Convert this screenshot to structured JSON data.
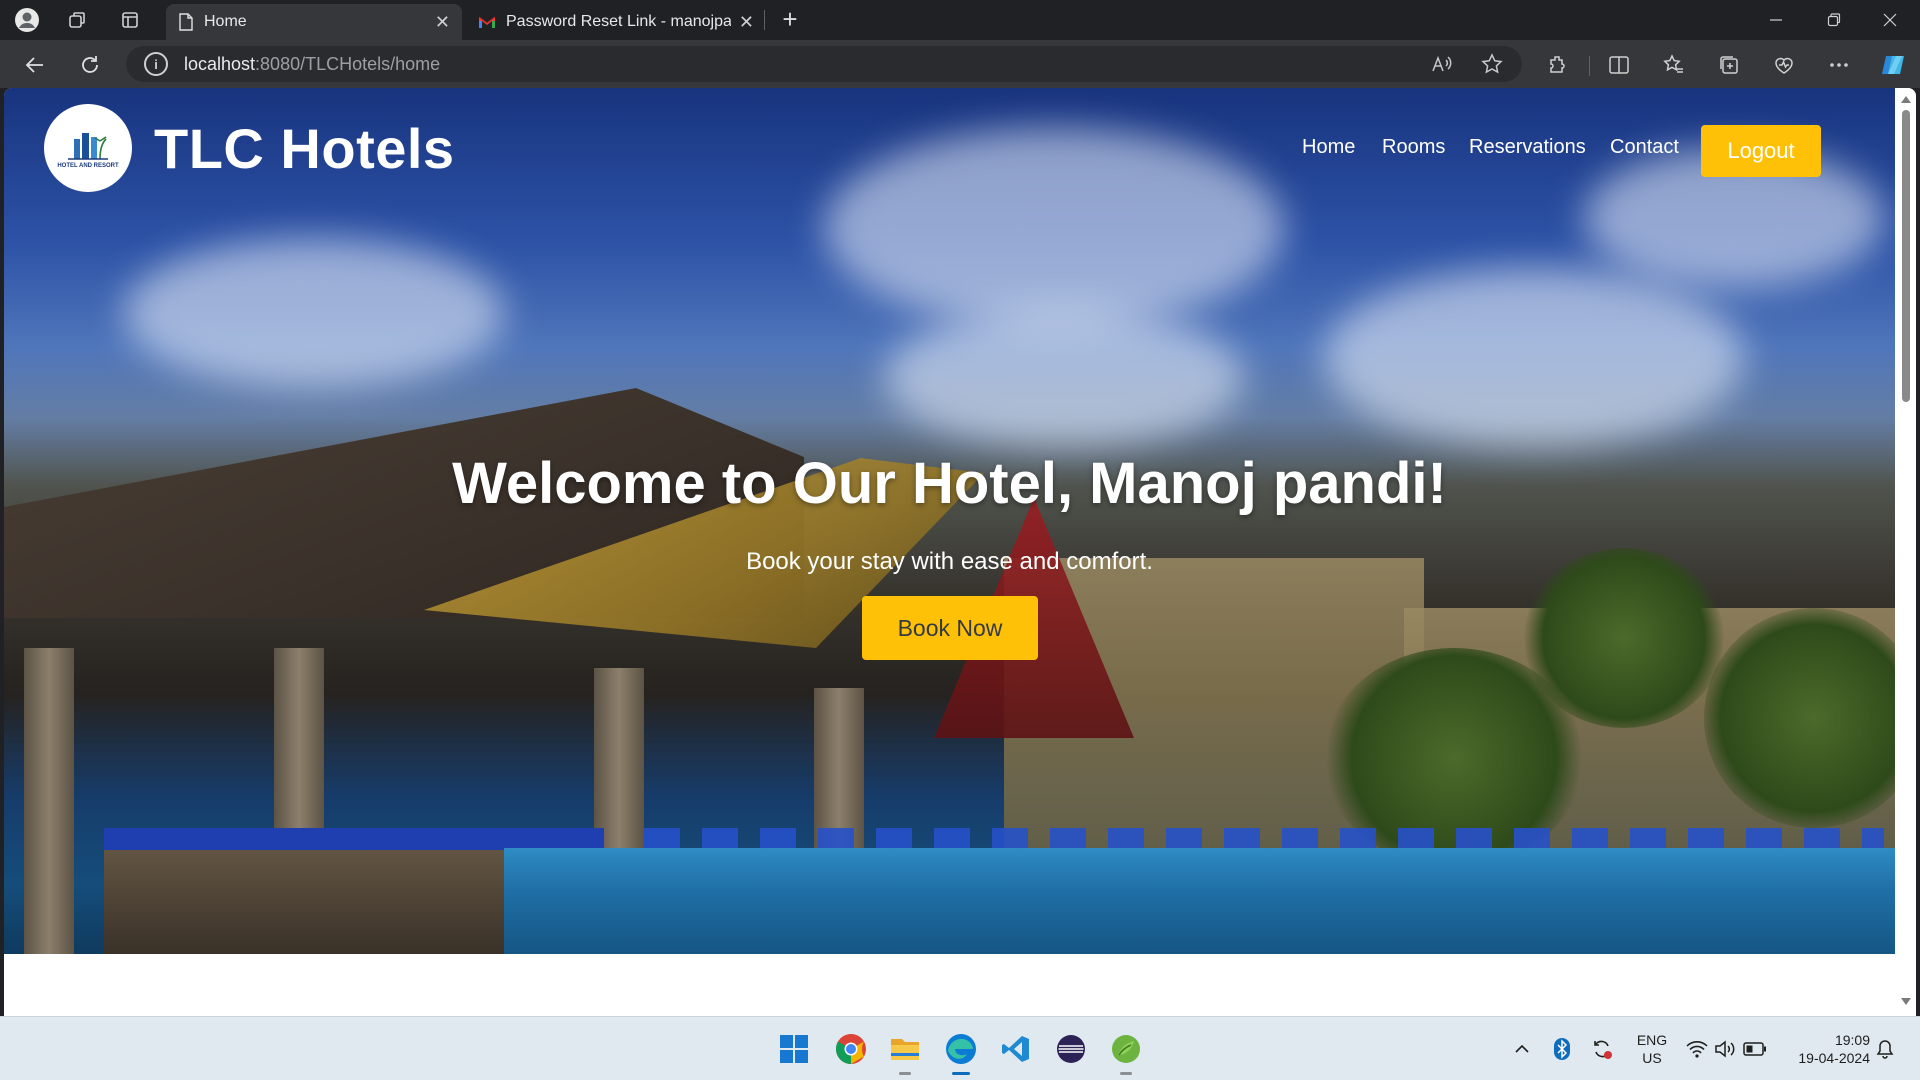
{
  "browser": {
    "tabs": [
      {
        "title": "Home",
        "active": true,
        "icon": "page-icon"
      },
      {
        "title": "Password Reset Link - manojpandi",
        "active": false,
        "icon": "gmail-icon"
      }
    ],
    "url_host": "localhost",
    "url_rest": ":8080/TLCHotels/home"
  },
  "site": {
    "brand": "TLC Hotels",
    "logo_caption": "HOTEL AND RESORT",
    "nav": [
      "Home",
      "Rooms",
      "Reservations",
      "Contact"
    ],
    "logout_label": "Logout",
    "hero_title": "Welcome to Our Hotel, Manoj pandi!",
    "hero_subtitle": "Book your stay with ease and comfort.",
    "book_label": "Book Now",
    "accent_color": "#ffc107"
  },
  "taskbar": {
    "lang_top": "ENG",
    "lang_bottom": "US",
    "time": "19:09",
    "date": "19-04-2024"
  }
}
